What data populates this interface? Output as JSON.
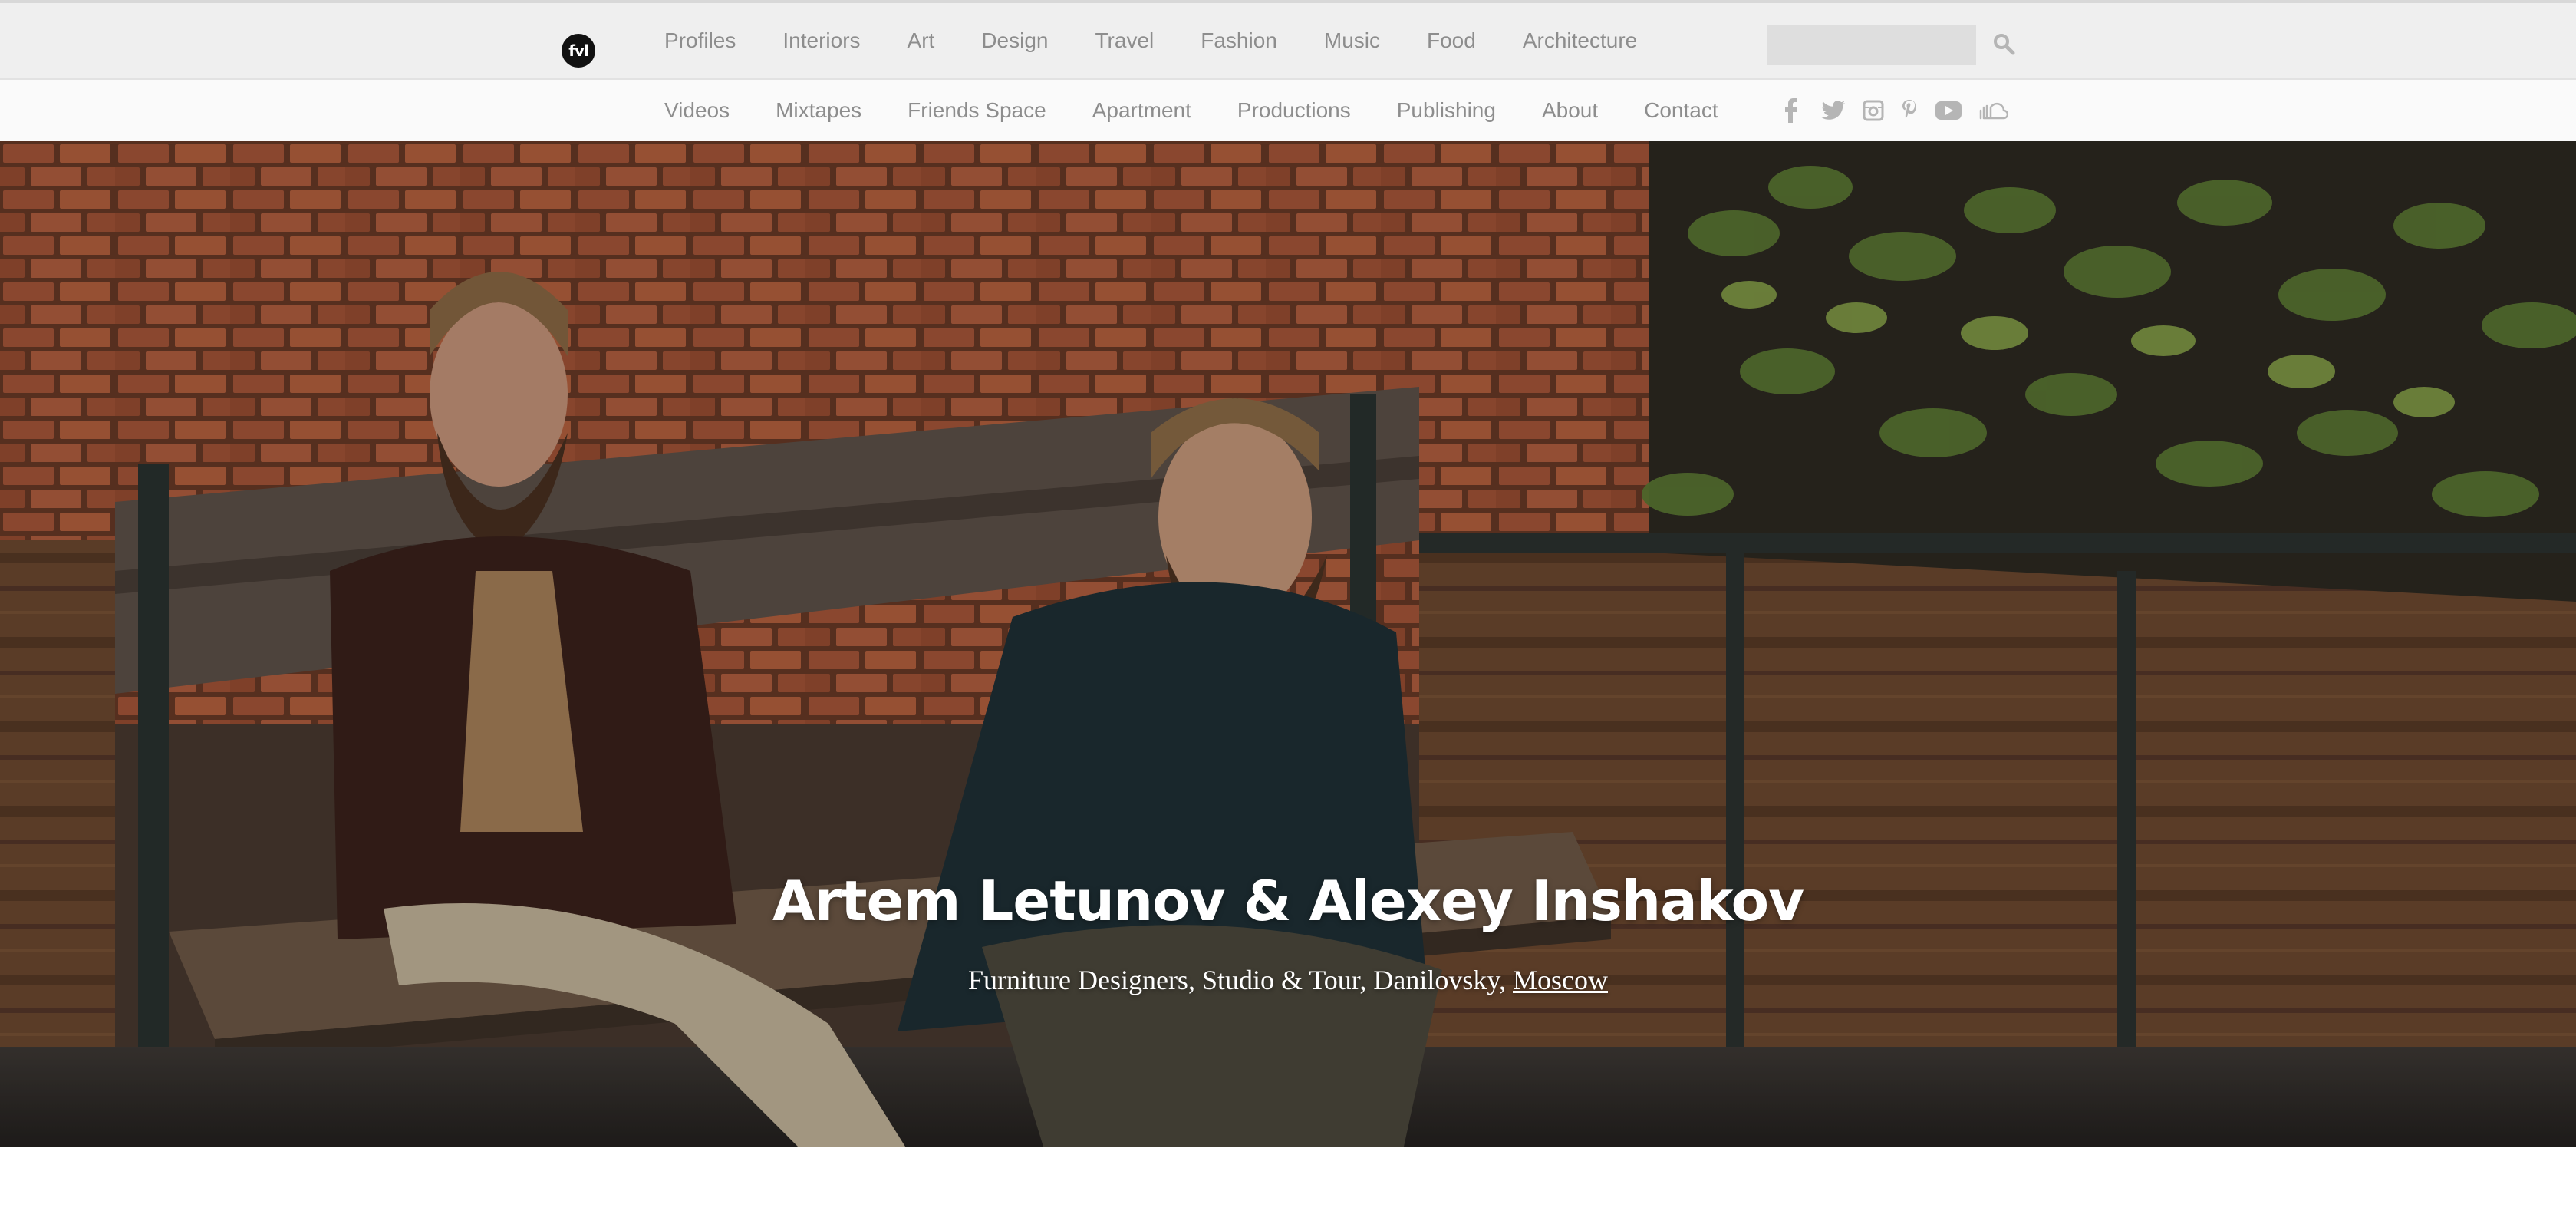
{
  "brand": {
    "logo_text": "fvl"
  },
  "nav_primary": [
    {
      "label": "Profiles"
    },
    {
      "label": "Interiors"
    },
    {
      "label": "Art"
    },
    {
      "label": "Design"
    },
    {
      "label": "Travel"
    },
    {
      "label": "Fashion"
    },
    {
      "label": "Music"
    },
    {
      "label": "Food"
    },
    {
      "label": "Architecture"
    }
  ],
  "nav_secondary": [
    {
      "label": "Videos"
    },
    {
      "label": "Mixtapes"
    },
    {
      "label": "Friends Space"
    },
    {
      "label": "Apartment"
    },
    {
      "label": "Productions"
    },
    {
      "label": "Publishing"
    },
    {
      "label": "About"
    },
    {
      "label": "Contact"
    }
  ],
  "search": {
    "placeholder": "",
    "value": ""
  },
  "social_icons": [
    "facebook-icon",
    "twitter-icon",
    "instagram-icon",
    "pinterest-icon",
    "youtube-icon",
    "soundcloud-icon"
  ],
  "hero": {
    "title": "Artem Letunov & Alexey Inshakov",
    "subtitle_prefix": "Furniture Designers, Studio & Tour, Danilovsky, ",
    "subtitle_link": "Moscow"
  },
  "colors": {
    "nav_text": "#8d8d8d",
    "nav_bg": "#efefef",
    "subnav_bg": "#fafafa",
    "icon": "#b5b5b5"
  }
}
